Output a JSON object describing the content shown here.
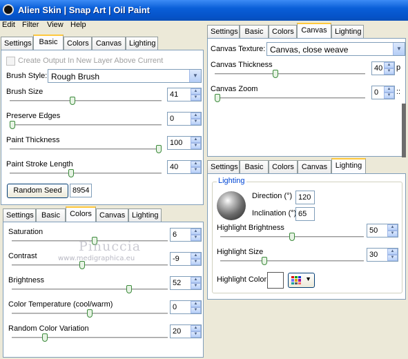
{
  "window": {
    "title": "Alien Skin | Snap Art | Oil Paint"
  },
  "menu": [
    "Edit",
    "Filter",
    "View",
    "Help"
  ],
  "tabs_top_left": [
    "Settings",
    "Basic",
    "Colors",
    "Canvas",
    "Lighting"
  ],
  "tabs_bottom_left": [
    "Settings",
    "Basic",
    "Colors",
    "Canvas",
    "Lighting"
  ],
  "tabs_top_right": [
    "Settings",
    "Basic",
    "Colors",
    "Canvas",
    "Lighting"
  ],
  "tabs_bottom_right": [
    "Settings",
    "Basic",
    "Colors",
    "Canvas",
    "Lighting"
  ],
  "basic": {
    "create_output_label": "Create Output In New Layer Above Current",
    "create_output_checked": false,
    "brush_style_label": "Brush Style:",
    "brush_style_value": "Rough Brush",
    "sliders": [
      {
        "label": "Brush Size",
        "value": "41",
        "level": 0.41
      },
      {
        "label": "Preserve Edges",
        "value": "0",
        "level": 0.0
      },
      {
        "label": "Paint Thickness",
        "value": "100",
        "level": 1.0
      },
      {
        "label": "Paint Stroke Length",
        "value": "40",
        "level": 0.4
      }
    ],
    "random_seed_button": "Random Seed",
    "random_seed_value": "8954"
  },
  "colors": {
    "sliders": [
      {
        "label": "Saturation",
        "value": "6",
        "level": 0.53
      },
      {
        "label": "Contrast",
        "value": "-9",
        "level": 0.45
      },
      {
        "label": "Brightness",
        "value": "52",
        "level": 0.76
      },
      {
        "label": "Color Temperature (cool/warm)",
        "value": "0",
        "level": 0.5
      },
      {
        "label": "Random Color Variation",
        "value": "20",
        "level": 0.2
      }
    ]
  },
  "watermark": {
    "name": "Pinuccia",
    "url": "www.medigraphica.eu"
  },
  "canvas": {
    "texture_label": "Canvas Texture:",
    "texture_value": "Canvas, close weave",
    "sliders": [
      {
        "label": "Canvas Thickness",
        "value": "40",
        "level": 0.4,
        "unit_clip": "p"
      },
      {
        "label": "Canvas Zoom",
        "value": "0",
        "level": 0.0,
        "unit_clip": "::"
      }
    ]
  },
  "lighting": {
    "group_label": "Lighting",
    "direction_label": "Direction (°)",
    "direction_value": "120",
    "inclination_label": "Inclination (°)",
    "inclination_value": "65",
    "sliders": [
      {
        "label": "Highlight Brightness",
        "value": "50",
        "level": 0.5
      },
      {
        "label": "Highlight Size",
        "value": "30",
        "level": 0.3
      }
    ],
    "highlight_color_label": "Highlight Color",
    "highlight_color": "#ffffff"
  },
  "colors_accent": {
    "titlebar": "#0553c9",
    "tab_active_top": "#ffc83c",
    "slider_thumb": "#3b8a3b",
    "group_legend": "#0046d5"
  },
  "icons": {
    "app": "alien-skin-app-icon",
    "spin_up": "spin-up-arrow-icon",
    "spin_down": "spin-down-arrow-icon",
    "dropdown": "chevron-down-icon",
    "color_palette": "color-palette-icon"
  }
}
